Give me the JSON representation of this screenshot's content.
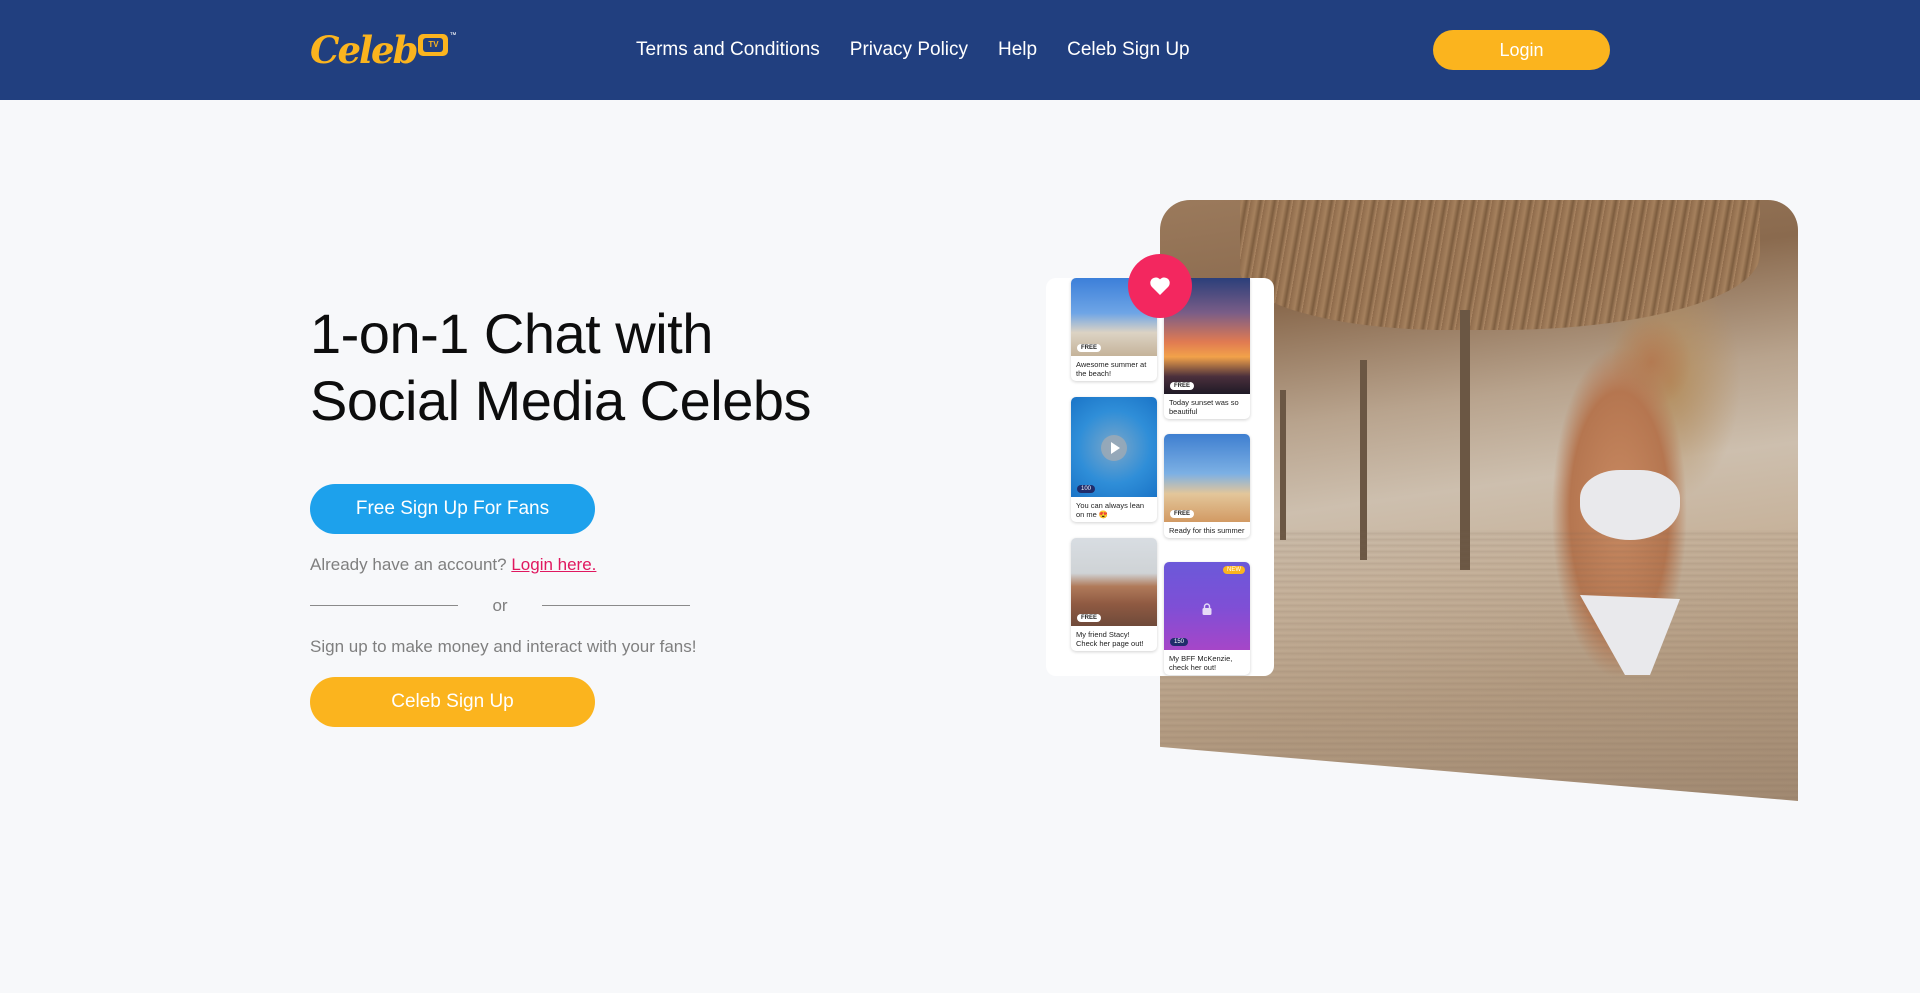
{
  "header": {
    "logo_text": "Celeb",
    "logo_badge": "TV",
    "logo_tm": "™",
    "nav": [
      {
        "label": "Terms and Conditions"
      },
      {
        "label": "Privacy Policy"
      },
      {
        "label": "Help"
      },
      {
        "label": "Celeb Sign Up"
      }
    ],
    "login_label": "Login"
  },
  "hero": {
    "title_line1": "1-on-1 Chat with",
    "title_line2": "Social Media Celebs",
    "fan_signup_label": "Free Sign Up For Fans",
    "account_prompt": "Already have an account?",
    "login_link": "Login here.",
    "divider_text": "or",
    "celeb_prompt": "Sign up to make money and interact with your fans!",
    "celeb_signup_label": "Celeb Sign Up"
  },
  "feed": {
    "cards": [
      {
        "caption": "Awesome summer at the beach!",
        "badge": "FREE"
      },
      {
        "caption": "You can always lean on me 😍",
        "badge": "100"
      },
      {
        "caption": "My friend Stacy! Check her page out!",
        "badge": "FREE"
      },
      {
        "caption": "Today sunset was so beautiful",
        "badge": "FREE"
      },
      {
        "caption": "Ready for this summer",
        "badge": "FREE"
      },
      {
        "caption": "My BFF McKenzie, check her out!",
        "badge": "150",
        "tag": "NEW"
      }
    ]
  },
  "colors": {
    "header_bg": "#213f7f",
    "accent_yellow": "#fbb41e",
    "accent_blue": "#1da1ec",
    "link_pink": "#e0175f",
    "heart_red": "#f3275f"
  },
  "icons": {
    "heart": "heart-icon",
    "play": "play-icon",
    "lock": "lock-icon",
    "coin": "coin-icon"
  }
}
